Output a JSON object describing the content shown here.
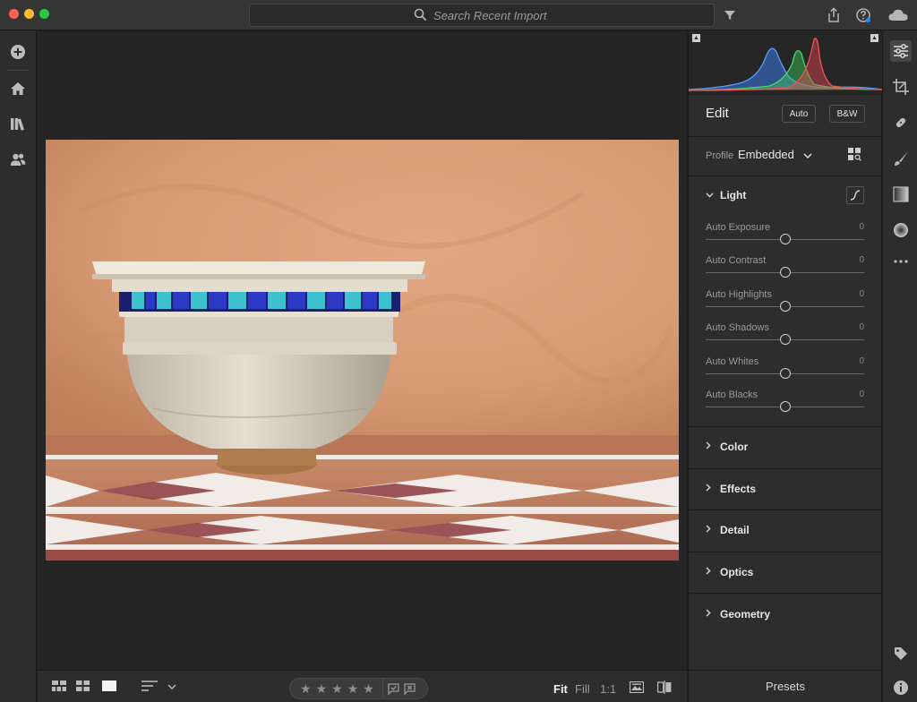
{
  "window": {
    "search_placeholder": "Search Recent Import"
  },
  "icons": {
    "titlebar": [
      "search-icon",
      "filter-icon",
      "share-icon",
      "help-icon",
      "cloud-icon"
    ],
    "left_sidebar": [
      "add-photos-icon",
      "home-icon",
      "library-icon",
      "people-icon"
    ],
    "tool_strip": [
      "edit-sliders-icon",
      "crop-icon",
      "healing-icon",
      "brush-icon",
      "linear-gradient-icon",
      "radial-gradient-icon",
      "more-icon",
      "keyword-tag-icon",
      "info-icon"
    ],
    "bottom": [
      "square-grid-icon",
      "photo-grid-icon",
      "detail-view-icon",
      "sort-icon",
      "sort-chevron-icon",
      "pick-flag-icon",
      "reject-flag-icon",
      "compare-icon",
      "before-after-icon"
    ]
  },
  "bottom_bar": {
    "stars": [
      "★",
      "★",
      "★",
      "★",
      "★"
    ],
    "fit_label": "Fit",
    "fill_label": "Fill",
    "one_to_one_label": "1:1"
  },
  "edit_panel": {
    "title": "Edit",
    "auto_button": "Auto",
    "bw_button": "B&W",
    "profile_label": "Profile",
    "profile_value": "Embedded",
    "light": {
      "label": "Light",
      "sliders": [
        {
          "label": "Auto Exposure",
          "value": "0",
          "position": 0.5
        },
        {
          "label": "Auto Contrast",
          "value": "0",
          "position": 0.5
        },
        {
          "label": "Auto Highlights",
          "value": "0",
          "position": 0.5
        },
        {
          "label": "Auto Shadows",
          "value": "0",
          "position": 0.5
        },
        {
          "label": "Auto Whites",
          "value": "0",
          "position": 0.5
        },
        {
          "label": "Auto Blacks",
          "value": "0",
          "position": 0.5
        }
      ]
    },
    "sections": [
      "Color",
      "Effects",
      "Detail",
      "Optics",
      "Geometry"
    ],
    "presets_label": "Presets"
  },
  "colors": {
    "accent_active": "#464646",
    "panel_bg": "#2d2d2d",
    "canvas_bg": "#252525",
    "histogram_red": "#e5484d",
    "histogram_green": "#3ccf5a",
    "histogram_blue": "#3b82f6"
  }
}
